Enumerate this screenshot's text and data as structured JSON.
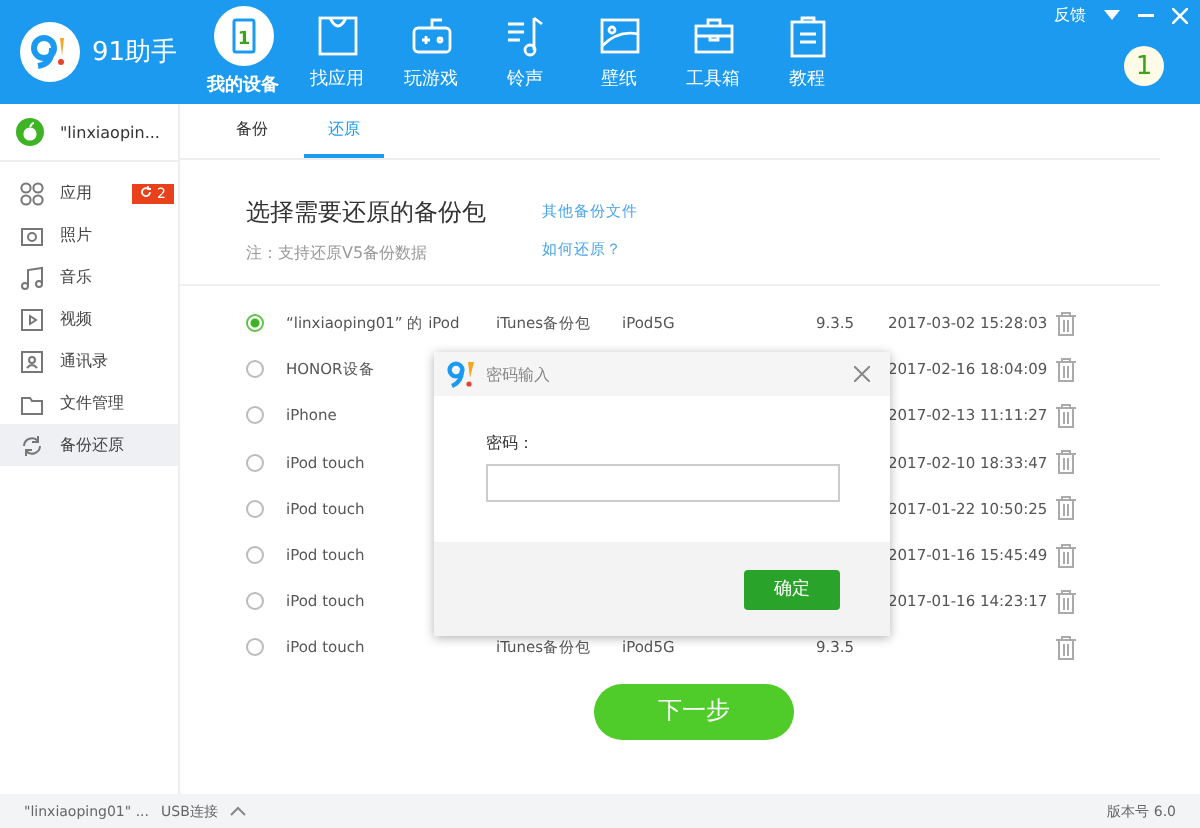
{
  "app": {
    "logo_text": "91助手",
    "window_controls": {
      "feedback": "反馈"
    },
    "badge_number": "1"
  },
  "nav": [
    {
      "label": "我的设备",
      "selected": true,
      "kind": "device",
      "icon_text": "1"
    },
    {
      "label": "找应用",
      "selected": false,
      "kind": "bag"
    },
    {
      "label": "玩游戏",
      "selected": false,
      "kind": "game"
    },
    {
      "label": "铃声",
      "selected": false,
      "kind": "music"
    },
    {
      "label": "壁纸",
      "selected": false,
      "kind": "picture"
    },
    {
      "label": "工具箱",
      "selected": false,
      "kind": "toolbox"
    },
    {
      "label": "教程",
      "selected": false,
      "kind": "clipboard"
    }
  ],
  "device": {
    "name": "\"linxiaopin..."
  },
  "sidebar": {
    "items": [
      {
        "label": "应用",
        "kind": "apps",
        "selected": false,
        "badge": "2"
      },
      {
        "label": "照片",
        "kind": "photo",
        "selected": false
      },
      {
        "label": "音乐",
        "kind": "music",
        "selected": false
      },
      {
        "label": "视频",
        "kind": "video",
        "selected": false
      },
      {
        "label": "通讯录",
        "kind": "contacts",
        "selected": false
      },
      {
        "label": "文件管理",
        "kind": "folder",
        "selected": false
      },
      {
        "label": "备份还原",
        "kind": "sync",
        "selected": true
      }
    ]
  },
  "tabs": [
    {
      "label": "备份",
      "selected": false
    },
    {
      "label": "还原",
      "selected": true
    }
  ],
  "restore": {
    "title": "选择需要还原的备份包",
    "note": "注：支持还原V5备份数据",
    "links": [
      "其他备份文件",
      "如何还原？"
    ],
    "rows": [
      {
        "selected": true,
        "name": "“linxiaoping01” 的 iPod",
        "type": "iTunes备份包",
        "model": "iPod5G",
        "version": "9.3.5",
        "time": "2017-03-02 15:28:03"
      },
      {
        "selected": false,
        "name": "HONOR设备",
        "time": "2017-02-16 18:04:09"
      },
      {
        "selected": false,
        "name": "iPhone",
        "time": "2017-02-13 11:11:27"
      },
      {
        "selected": false,
        "name": "iPod touch",
        "time": "2017-02-10 18:33:47"
      },
      {
        "selected": false,
        "name": "iPod touch",
        "time": "2017-01-22 10:50:25"
      },
      {
        "selected": false,
        "name": "iPod touch",
        "time": "2017-01-16 15:45:49"
      },
      {
        "selected": false,
        "name": "iPod touch",
        "time": "2017-01-16 14:23:17"
      },
      {
        "selected": false,
        "name": "iPod touch",
        "type": "iTunes备份包",
        "model": "iPod5G",
        "version": "9.3.5"
      }
    ],
    "next_button": "下一步"
  },
  "dialog": {
    "title": "密码输入",
    "field_label": "密码：",
    "confirm": "确定"
  },
  "status_bar": {
    "device": "\"linxiaoping01\" ...",
    "connection": "USB连接",
    "version": "版本号 6.0"
  }
}
